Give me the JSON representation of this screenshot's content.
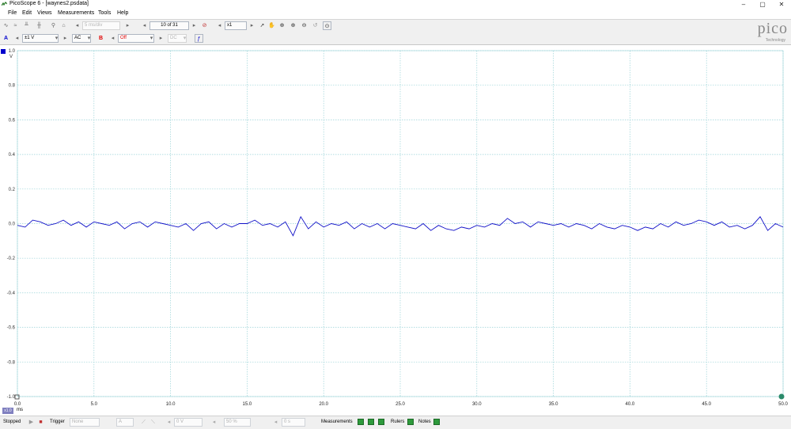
{
  "window": {
    "title": "PicoScope 6 - [waynes2.psdata]",
    "minimize": "–",
    "maximize": "▢",
    "close": "✕"
  },
  "menu": [
    "File",
    "Edit",
    "Views",
    "Measurements",
    "Tools",
    "Help"
  ],
  "toolbar": {
    "sample_count": "5 ms/div",
    "capture_index": "10 of 31",
    "zoom": "x1"
  },
  "channels": {
    "a": {
      "letter": "A",
      "range": "±1 V",
      "coupling": "AC",
      "color": "#0000cc"
    },
    "b": {
      "letter": "B",
      "range": "Off",
      "coupling": "DC",
      "color": "#e00000"
    }
  },
  "logo": {
    "word": "pico",
    "subtitle": "Technology"
  },
  "chart_data": {
    "type": "line",
    "x": [
      0.0,
      0.5,
      1.0,
      1.5,
      2.0,
      2.5,
      3.0,
      3.5,
      4.0,
      4.5,
      5.0,
      5.5,
      6.0,
      6.5,
      7.0,
      7.5,
      8.0,
      8.5,
      9.0,
      9.5,
      10.0,
      10.5,
      11.0,
      11.5,
      12.0,
      12.5,
      13.0,
      13.5,
      14.0,
      14.5,
      15.0,
      15.5,
      16.0,
      16.5,
      17.0,
      17.5,
      18.0,
      18.5,
      19.0,
      19.5,
      20.0,
      20.5,
      21.0,
      21.5,
      22.0,
      22.5,
      23.0,
      23.5,
      24.0,
      24.5,
      25.0,
      25.5,
      26.0,
      26.5,
      27.0,
      27.5,
      28.0,
      28.5,
      29.0,
      29.5,
      30.0,
      30.5,
      31.0,
      31.5,
      32.0,
      32.5,
      33.0,
      33.5,
      34.0,
      34.5,
      35.0,
      35.5,
      36.0,
      36.5,
      37.0,
      37.5,
      38.0,
      38.5,
      39.0,
      39.5,
      40.0,
      40.5,
      41.0,
      41.5,
      42.0,
      42.5,
      43.0,
      43.5,
      44.0,
      44.5,
      45.0,
      45.5,
      46.0,
      46.5,
      47.0,
      47.5,
      48.0,
      48.5,
      49.0,
      49.5,
      50.0
    ],
    "series": [
      {
        "values": [
          -0.01,
          -0.02,
          0.02,
          0.01,
          -0.01,
          0.0,
          0.02,
          -0.01,
          0.01,
          -0.02,
          0.01,
          0.0,
          -0.01,
          0.01,
          -0.03,
          0.0,
          0.01,
          -0.02,
          0.01,
          0.0,
          -0.01,
          -0.02,
          0.0,
          -0.04,
          0.0,
          0.01,
          -0.03,
          0.0,
          -0.02,
          0.0,
          0.0,
          0.02,
          -0.01,
          0.0,
          -0.02,
          0.01,
          -0.07,
          0.04,
          -0.03,
          0.01,
          -0.02,
          0.0,
          -0.01,
          0.01,
          -0.03,
          0.0,
          -0.02,
          0.0,
          -0.03,
          0.0,
          -0.01,
          -0.02,
          -0.03,
          0.0,
          -0.04,
          -0.01,
          -0.03,
          -0.04,
          -0.02,
          -0.03,
          -0.01,
          -0.02,
          0.0,
          -0.01,
          0.03,
          0.0,
          0.01,
          -0.02,
          0.01,
          0.0,
          -0.01,
          0.0,
          -0.02,
          0.0,
          -0.01,
          -0.03,
          0.0,
          -0.02,
          -0.03,
          -0.01,
          -0.02,
          -0.04,
          -0.02,
          -0.03,
          0.0,
          -0.02,
          0.01,
          -0.01,
          0.0,
          0.02,
          0.01,
          -0.01,
          0.01,
          -0.02,
          -0.01,
          -0.03,
          -0.01,
          0.04,
          -0.04,
          0.0,
          -0.02
        ]
      }
    ],
    "xlim": [
      0,
      50
    ],
    "ylim": [
      -1.0,
      1.0
    ],
    "xticks": [
      "0.0",
      "5.0",
      "10.0",
      "15.0",
      "20.0",
      "25.0",
      "30.0",
      "35.0",
      "40.0",
      "45.0",
      "50.0"
    ],
    "yticks": [
      "1.0",
      "0.8",
      "0.6",
      "0.4",
      "0.2",
      "0.0",
      "-0.2",
      "-0.4",
      "-0.6",
      "-0.8",
      "-1.0"
    ],
    "ylabel": "V",
    "xlabel": "ms",
    "grid": true,
    "line_color": "#1010c8"
  },
  "xunit_badge": "x1.0",
  "status": {
    "stopped": "Stopped",
    "trigger_label": "Trigger",
    "trigger_mode": "None",
    "trigger_channel": "A",
    "trigger_level": "0 V",
    "trigger_percent": "50 %",
    "trigger_delay": "0 s",
    "measurements": "Measurements",
    "rulers": "Rulers",
    "notes": "Notes"
  }
}
